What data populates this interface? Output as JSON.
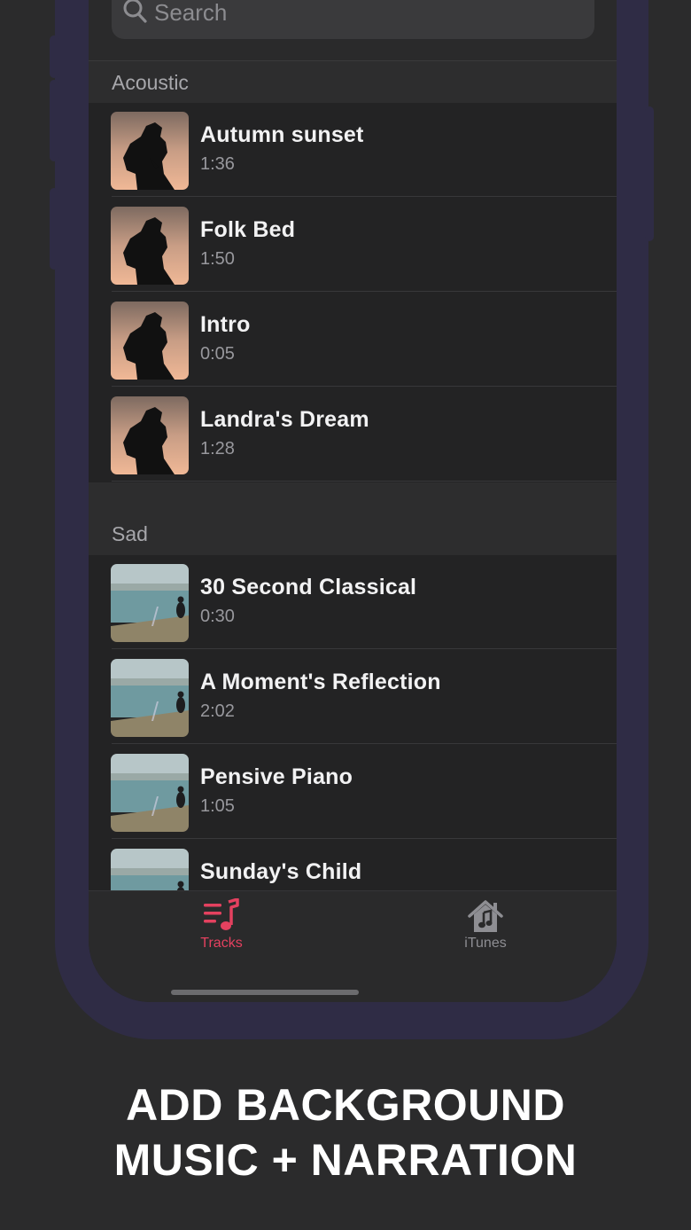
{
  "search": {
    "placeholder": "Search"
  },
  "sections": [
    {
      "title": "Acoustic",
      "thumb": "hiker-silhouette-sunset",
      "tracks": [
        {
          "title": "Autumn sunset",
          "duration": "1:36"
        },
        {
          "title": "Folk Bed",
          "duration": "1:50"
        },
        {
          "title": "Intro",
          "duration": "0:05"
        },
        {
          "title": "Landra's Dream",
          "duration": "1:28"
        }
      ]
    },
    {
      "title": "Sad",
      "thumb": "person-sitting-by-sea",
      "tracks": [
        {
          "title": "30 Second Classical",
          "duration": "0:30"
        },
        {
          "title": "A Moment's Reflection",
          "duration": "2:02"
        },
        {
          "title": "Pensive Piano",
          "duration": "1:05"
        },
        {
          "title": "Sunday's Child",
          "duration": ""
        }
      ]
    }
  ],
  "tabbar": {
    "tabs": [
      {
        "label": "Tracks",
        "icon": "music-list-icon",
        "active": true
      },
      {
        "label": "iTunes",
        "icon": "music-house-icon",
        "active": false
      }
    ]
  },
  "colors": {
    "accent": "#e4415f",
    "inactive_tab": "#8e8e93",
    "frame": "#2f2c45",
    "background": "#2b2b2c"
  },
  "promo": {
    "line1": "ADD BACKGROUND",
    "line2": "MUSIC + NARRATION"
  }
}
